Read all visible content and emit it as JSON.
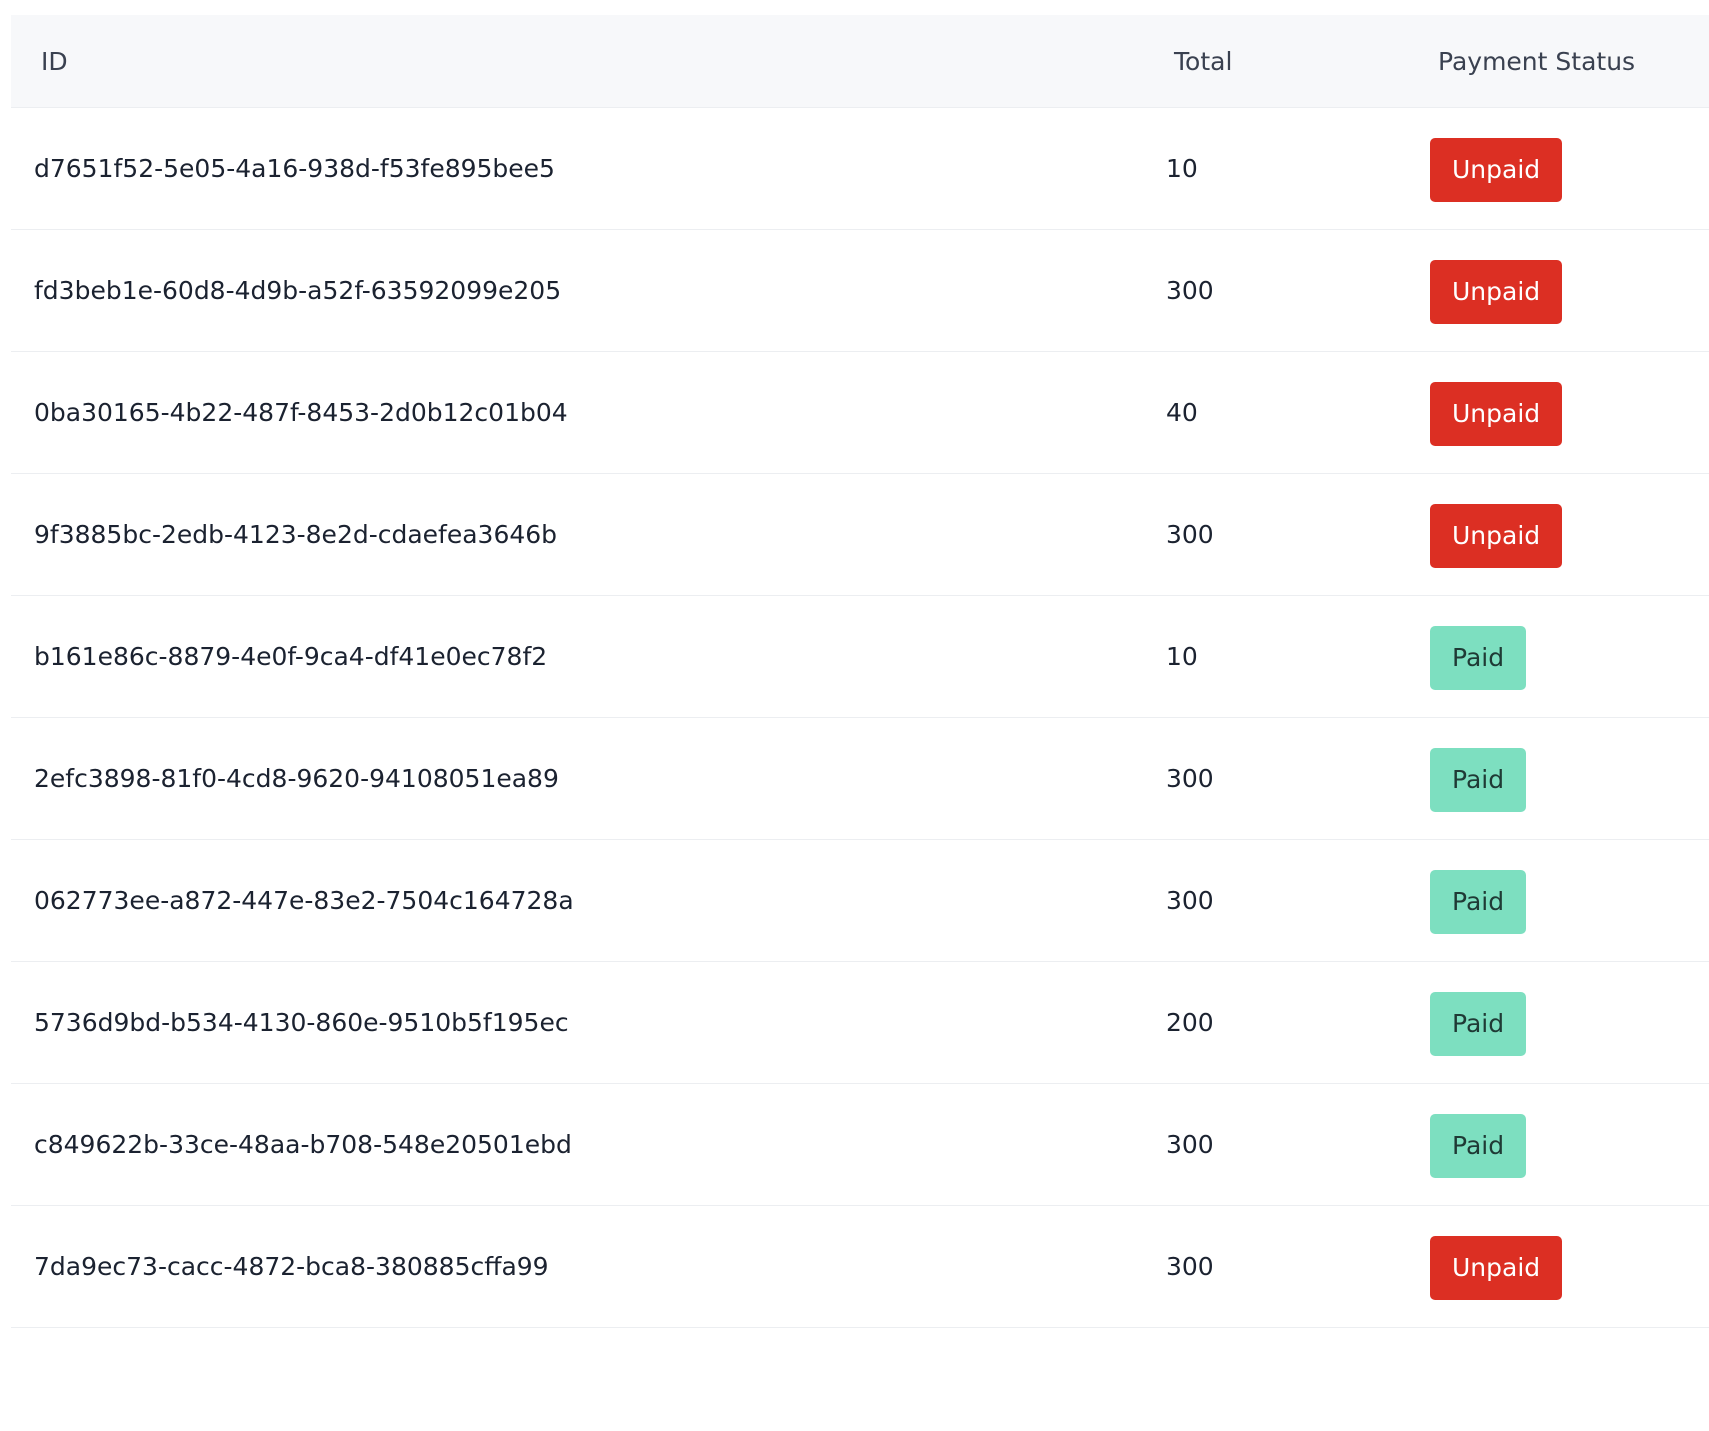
{
  "table": {
    "headers": {
      "id": "ID",
      "total": "Total",
      "status": "Payment Status"
    },
    "rows": [
      {
        "id": "d7651f52-5e05-4a16-938d-f53fe895bee5",
        "total": "10",
        "status": "Unpaid"
      },
      {
        "id": "fd3beb1e-60d8-4d9b-a52f-63592099e205",
        "total": "300",
        "status": "Unpaid"
      },
      {
        "id": "0ba30165-4b22-487f-8453-2d0b12c01b04",
        "total": "40",
        "status": "Unpaid"
      },
      {
        "id": "9f3885bc-2edb-4123-8e2d-cdaefea3646b",
        "total": "300",
        "status": "Unpaid"
      },
      {
        "id": "b161e86c-8879-4e0f-9ca4-df41e0ec78f2",
        "total": "10",
        "status": "Paid"
      },
      {
        "id": "2efc3898-81f0-4cd8-9620-94108051ea89",
        "total": "300",
        "status": "Paid"
      },
      {
        "id": "062773ee-a872-447e-83e2-7504c164728a",
        "total": "300",
        "status": "Paid"
      },
      {
        "id": "5736d9bd-b534-4130-860e-9510b5f195ec",
        "total": "200",
        "status": "Paid"
      },
      {
        "id": "c849622b-33ce-48aa-b708-548e20501ebd",
        "total": "300",
        "status": "Paid"
      },
      {
        "id": "7da9ec73-cacc-4872-bca8-380885cffa99",
        "total": "300",
        "status": "Unpaid"
      }
    ]
  },
  "colors": {
    "unpaid_badge": "#dc2f23",
    "paid_badge": "#7ddfc0",
    "header_bg": "#f7f8fa"
  }
}
